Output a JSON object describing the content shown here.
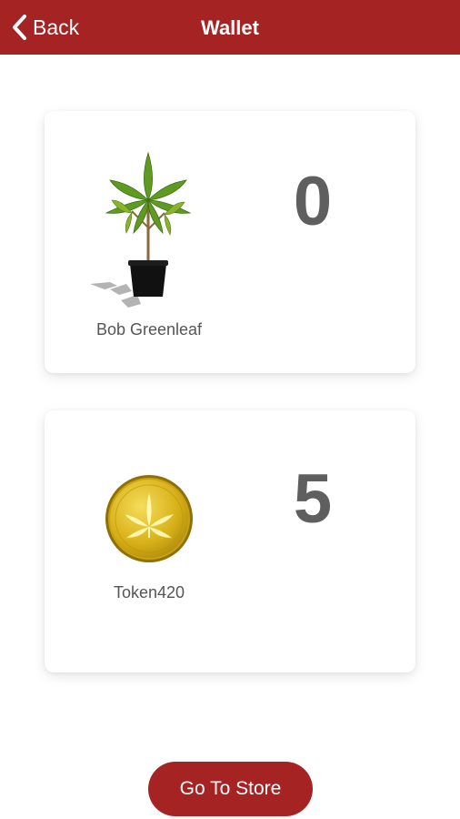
{
  "header": {
    "back_label": "Back",
    "title": "Wallet",
    "background_color": "#a52323"
  },
  "wallet": {
    "items": [
      {
        "name": "Bob Greenleaf",
        "count": "0",
        "icon": "plant-icon"
      },
      {
        "name": "Token420",
        "count": "5",
        "icon": "coin-icon"
      }
    ]
  },
  "footer": {
    "store_button_label": "Go To Store",
    "button_color": "#a52323"
  }
}
